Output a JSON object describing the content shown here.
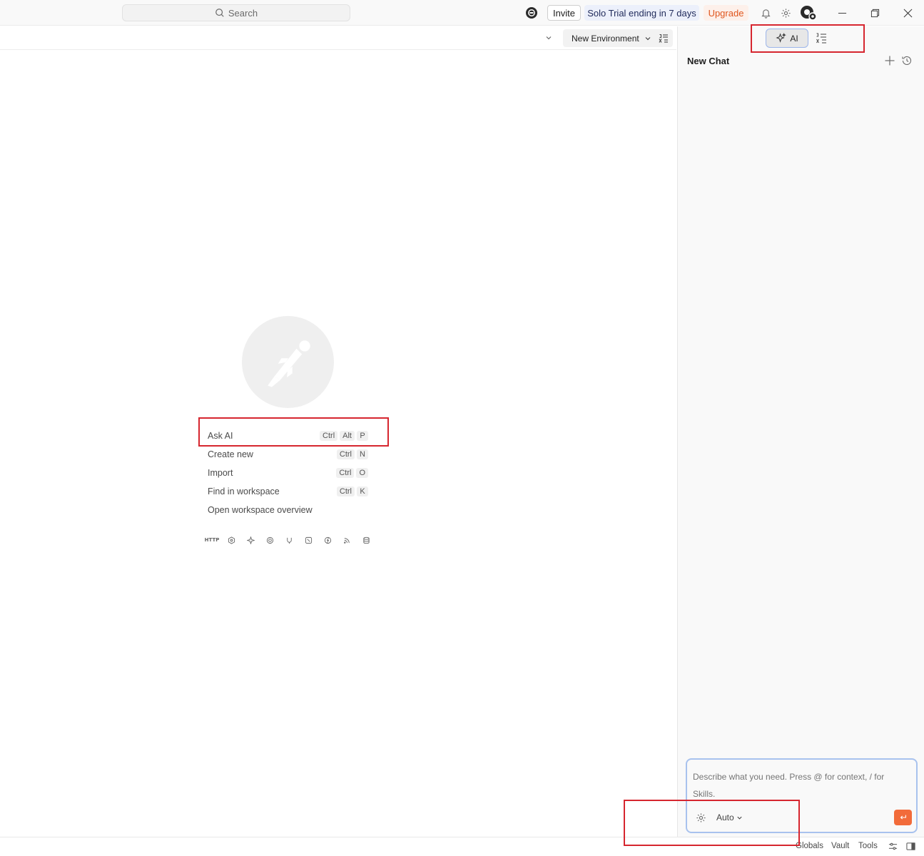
{
  "titlebar": {
    "search_placeholder": "Search",
    "invite_label": "Invite",
    "trial_label": "Solo Trial ending in 7 days",
    "upgrade_label": "Upgrade",
    "colors": {
      "upgrade": "#e0561d",
      "trial_bg": "#ecf0fb"
    }
  },
  "toolbar": {
    "environment_label": "New Environment"
  },
  "right_panel": {
    "ai_tab_label": "AI",
    "title": "New Chat",
    "chat_placeholder": "Describe what you need. Press @ for context, / for Skills.",
    "model_label": "Auto",
    "send_color": "#f26b3a"
  },
  "empty_state": {
    "items": [
      {
        "label": "Ask AI",
        "keys": [
          "Ctrl",
          "Alt",
          "P"
        ]
      },
      {
        "label": "Create new",
        "keys": [
          "Ctrl",
          "N"
        ]
      },
      {
        "label": "Import",
        "keys": [
          "Ctrl",
          "O"
        ]
      },
      {
        "label": "Find in workspace",
        "keys": [
          "Ctrl",
          "K"
        ]
      },
      {
        "label": "Open workspace overview",
        "keys": []
      }
    ],
    "type_icons": [
      "http-icon",
      "graphql-icon",
      "ai-icon",
      "grpc-icon",
      "websocket-icon",
      "socketio-icon",
      "mqtt-icon",
      "sse-icon",
      "database-icon"
    ],
    "http_glyph": "HTTP"
  },
  "statusbar": {
    "globals_label": "Globals",
    "vault_label": "Vault",
    "tools_label": "Tools"
  }
}
